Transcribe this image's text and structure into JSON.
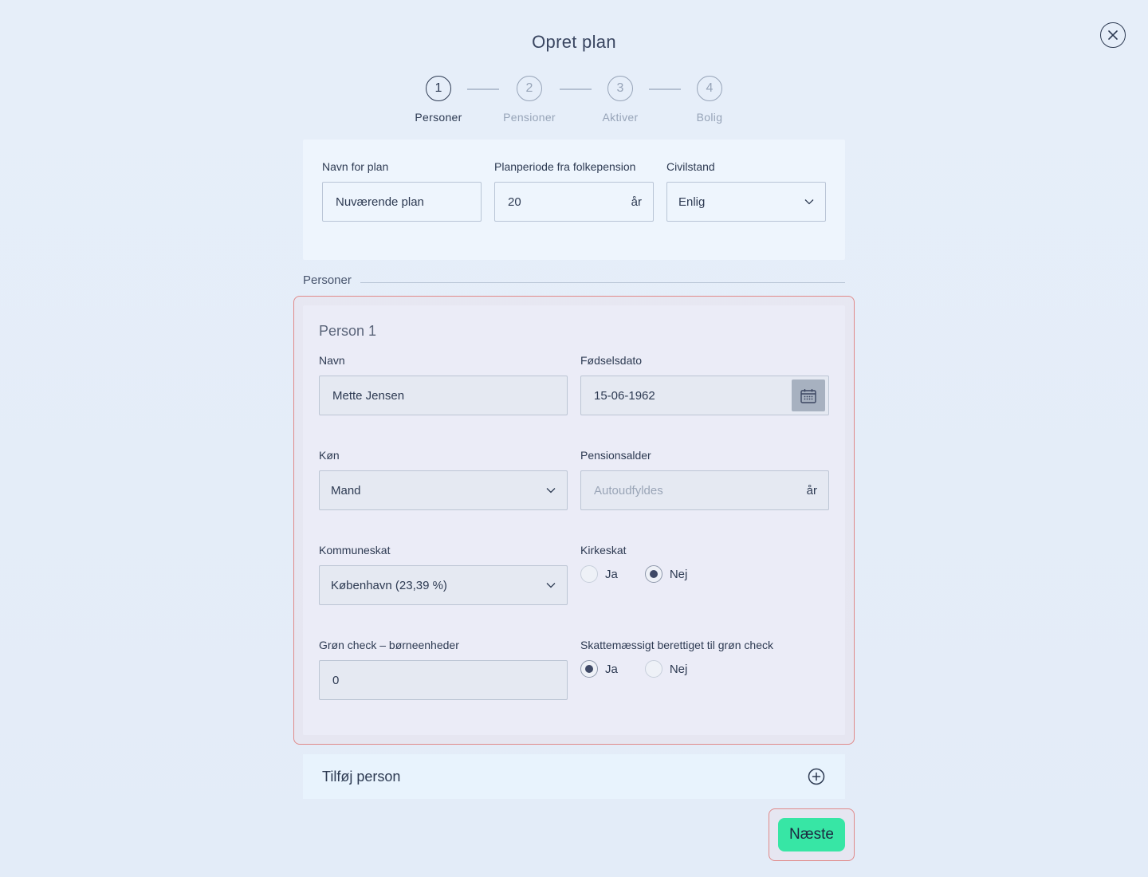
{
  "dialog": {
    "title": "Opret plan"
  },
  "steps": [
    {
      "num": "1",
      "label": "Personer"
    },
    {
      "num": "2",
      "label": "Pensioner"
    },
    {
      "num": "3",
      "label": "Aktiver"
    },
    {
      "num": "4",
      "label": "Bolig"
    }
  ],
  "plan": {
    "name_label": "Navn for plan",
    "name_value": "Nuværende plan",
    "period_label": "Planperiode fra folkepension",
    "period_value": "20",
    "period_suffix": "år",
    "civil_label": "Civilstand",
    "civil_value": "Enlig"
  },
  "persons_section": {
    "label": "Personer"
  },
  "person1": {
    "title": "Person 1",
    "name_label": "Navn",
    "name_value": "Mette Jensen",
    "dob_label": "Fødselsdato",
    "dob_value": "15-06-1962",
    "gender_label": "Køn",
    "gender_value": "Mand",
    "pension_age_label": "Pensionsalder",
    "pension_age_placeholder": "Autoudfyldes",
    "pension_age_suffix": "år",
    "municipal_tax_label": "Kommuneskat",
    "municipal_tax_value": "København (23,39 %)",
    "church_tax_label": "Kirkeskat",
    "church_yes": "Ja",
    "church_no": "Nej",
    "green_check_label": "Grøn check – børneenheder",
    "green_check_value": "0",
    "green_eligible_label": "Skattemæssigt berettiget til grøn check",
    "eligible_yes": "Ja",
    "eligible_no": "Nej"
  },
  "add_person": {
    "label": "Tilføj person"
  },
  "footer": {
    "next_label": "Næste"
  },
  "colors": {
    "accent": "#37e6a5",
    "highlight": "#e08a8a",
    "text": "#2d3a52"
  }
}
